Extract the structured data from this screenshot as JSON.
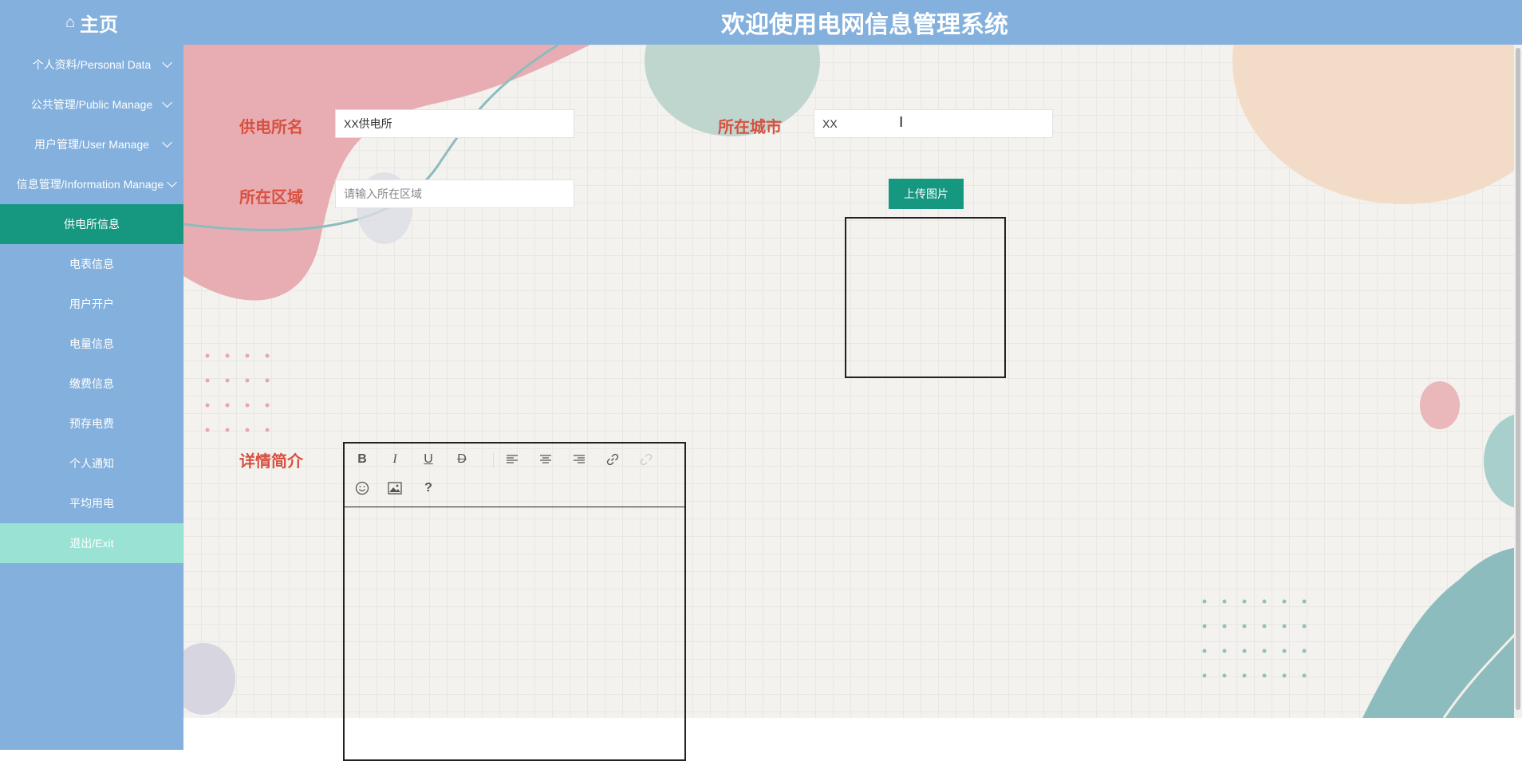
{
  "header": {
    "home_icon": "home-icon",
    "home_label": "主页",
    "title": "欢迎使用电网信息管理系统"
  },
  "sidebar": {
    "items": [
      {
        "label": "个人资料/Personal Data",
        "expandable": true
      },
      {
        "label": "公共管理/Public Manage",
        "expandable": true
      },
      {
        "label": "用户管理/User Manage",
        "expandable": true
      },
      {
        "label": "信息管理/Information Manage",
        "expandable": true
      },
      {
        "label": "供电所信息",
        "active": true
      },
      {
        "label": "电表信息"
      },
      {
        "label": "用户开户"
      },
      {
        "label": "电量信息"
      },
      {
        "label": "缴费信息"
      },
      {
        "label": "预存电费"
      },
      {
        "label": "个人通知"
      },
      {
        "label": "平均用电"
      },
      {
        "label": "退出/Exit"
      }
    ]
  },
  "form": {
    "station_name_label": "供电所名",
    "station_name_value": "XX供电所",
    "city_label": "所在城市",
    "city_value": "XX",
    "area_label": "所在区域",
    "area_placeholder": "请输入所在区域",
    "upload_button": "上传图片",
    "detail_label": "详情简介"
  },
  "editor": {
    "toolbar": [
      "bold-icon",
      "italic-icon",
      "underline-icon",
      "strikethrough-icon",
      "align-left-icon",
      "align-center-icon",
      "align-right-icon",
      "link-icon",
      "unlink-icon",
      "emoji-icon",
      "image-icon",
      "help-icon"
    ],
    "glyphs": {
      "bold": "B",
      "italic": "I",
      "underline": "U",
      "strike": "D",
      "help": "?"
    }
  },
  "colors": {
    "header_bg": "#83b0dc",
    "active_item": "#16977f",
    "exit_item": "#9ae2d3",
    "label_red": "#d9503f"
  }
}
